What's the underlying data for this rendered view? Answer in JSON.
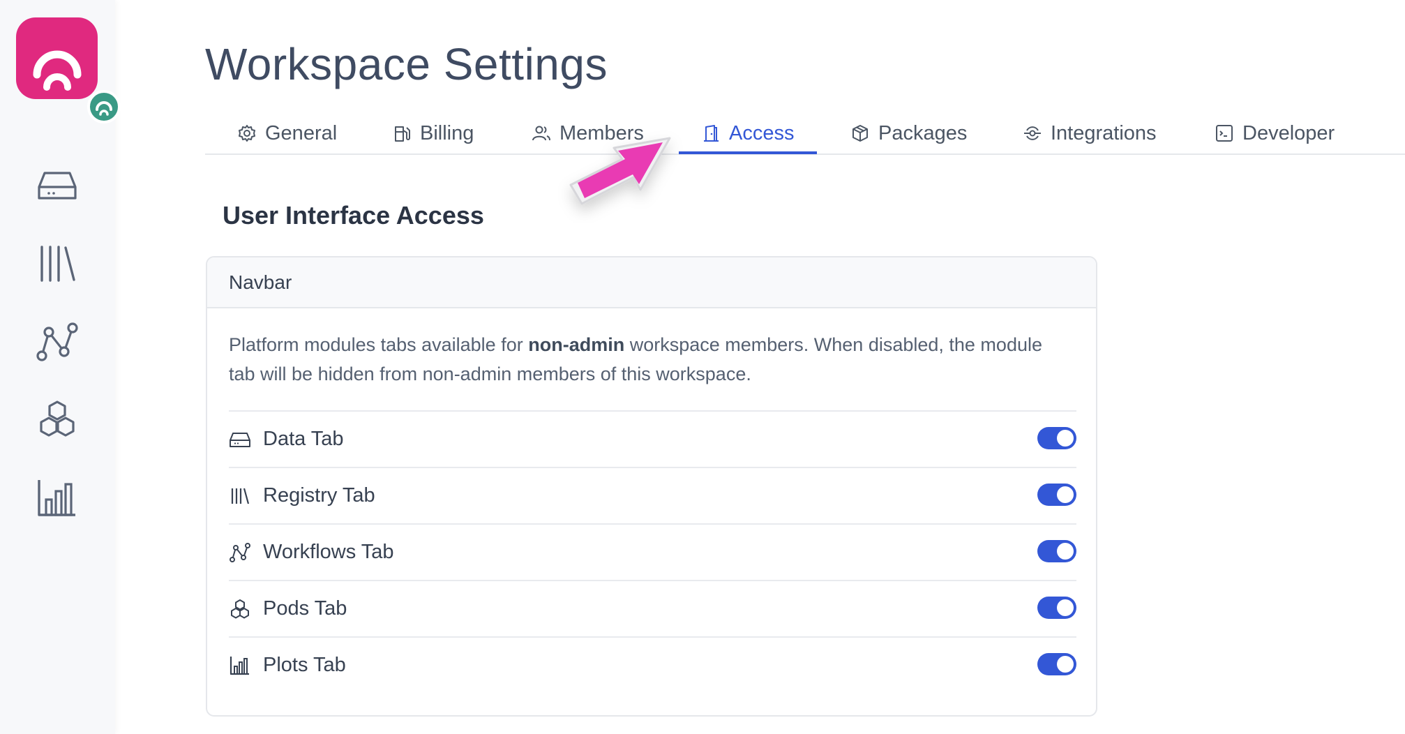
{
  "sidebar": {
    "items": [
      {
        "name": "data",
        "icon": "drive-icon"
      },
      {
        "name": "registry",
        "icon": "library-icon"
      },
      {
        "name": "workflows",
        "icon": "workflow-icon"
      },
      {
        "name": "pods",
        "icon": "pods-icon"
      },
      {
        "name": "plots",
        "icon": "bar-chart-icon"
      }
    ]
  },
  "header": {
    "title": "Workspace Settings"
  },
  "tabs": [
    {
      "label": "General",
      "icon": "gear-icon"
    },
    {
      "label": "Billing",
      "icon": "fuel-icon"
    },
    {
      "label": "Members",
      "icon": "users-icon"
    },
    {
      "label": "Access",
      "icon": "door-icon",
      "active": true
    },
    {
      "label": "Packages",
      "icon": "package-icon"
    },
    {
      "label": "Integrations",
      "icon": "integration-icon"
    },
    {
      "label": "Developer",
      "icon": "terminal-icon"
    }
  ],
  "section": {
    "title": "User Interface Access"
  },
  "card": {
    "header": "Navbar",
    "desc_part1": "Platform modules tabs available for ",
    "desc_bold": "non-admin",
    "desc_part2": " workspace members. When disabled, the module tab will be hidden from non-admin members of this workspace.",
    "rows": [
      {
        "label": "Data Tab",
        "icon": "drive-icon",
        "enabled": true
      },
      {
        "label": "Registry Tab",
        "icon": "library-icon",
        "enabled": true
      },
      {
        "label": "Workflows Tab",
        "icon": "workflow-icon",
        "enabled": true
      },
      {
        "label": "Pods Tab",
        "icon": "pods-icon",
        "enabled": true
      },
      {
        "label": "Plots Tab",
        "icon": "bar-chart-icon",
        "enabled": true
      }
    ]
  },
  "colors": {
    "accent": "#3357d6",
    "logo": "#e0297f",
    "logo_badge": "#3a9a85",
    "cursor": "#e93bb3"
  }
}
